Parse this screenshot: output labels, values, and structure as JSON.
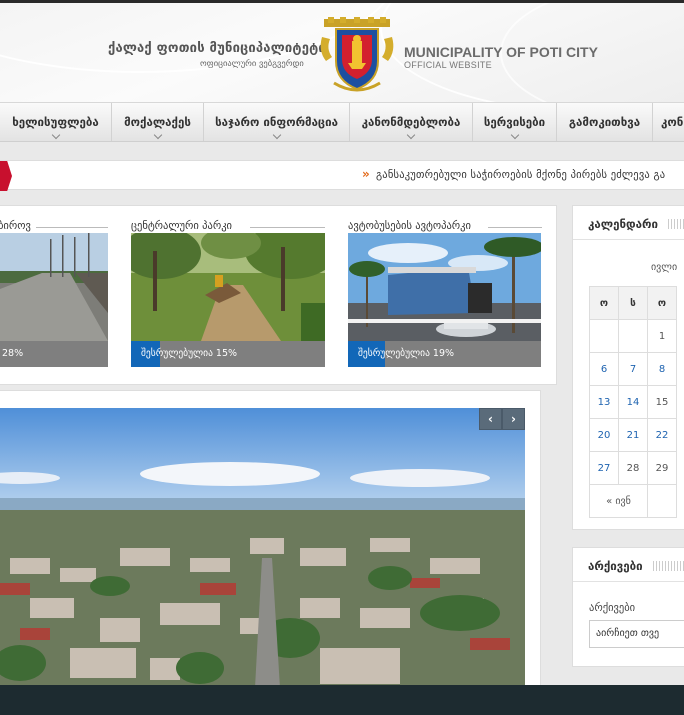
{
  "header": {
    "geo_title": "ქალაქ ფოთის მუნიციპალიტეტი",
    "geo_subtitle": "ოფიციალური ვებგვერდი",
    "en_title": "MUNICIPALITY OF POTI CITY",
    "en_subtitle": "OFFICIAL WEBSITE",
    "emblem_icon": "city-coat-of-arms-icon"
  },
  "nav": {
    "items": [
      {
        "label": "ხელისუფლება"
      },
      {
        "label": "მოქალაქეს"
      },
      {
        "label": "საჯარო ინფორმაცია"
      },
      {
        "label": "კანონმდებლობა"
      },
      {
        "label": "სერვისები"
      },
      {
        "label": "გამოკითხვა"
      },
      {
        "label": "კონ"
      }
    ]
  },
  "ticker": {
    "text": "განსაკუთრებული საჭიროების მქონე პირებს ეძლევა გა"
  },
  "projects": [
    {
      "title": "ბიროვ",
      "progress_label": "28%",
      "progress": 0.28
    },
    {
      "title": "ცენტრალური პარკი",
      "progress_label": "შესრულებულია 15%",
      "progress": 0.15
    },
    {
      "title": "ავტობუსების ავტოპარკი",
      "progress_label": "შესრულებულია 19%",
      "progress": 0.19
    }
  ],
  "slider": {
    "prev_icon": "chevron-left-icon",
    "next_icon": "chevron-right-icon",
    "prev_glyph": "‹",
    "next_glyph": "›"
  },
  "calendar": {
    "title": "კალენდარი",
    "month": "ივლი",
    "weekdays": [
      "ო",
      "ს",
      "ო"
    ],
    "rows": [
      [
        "",
        "",
        "1"
      ],
      [
        "6",
        "7",
        "8"
      ],
      [
        "13",
        "14",
        "15"
      ],
      [
        "20",
        "21",
        "22"
      ],
      [
        "27",
        "28",
        "29"
      ]
    ],
    "link_days": [
      "6",
      "7",
      "8",
      "13",
      "14",
      "20",
      "21",
      "22",
      "27"
    ],
    "prev_label": "« ივნ"
  },
  "archive": {
    "title": "არქივები",
    "label": "არქივები",
    "select_value": "აირჩიეთ თვე"
  },
  "colors": {
    "accent_blue": "#1267b8",
    "ticker_red": "#c8102e",
    "footer": "#1d2b30"
  }
}
